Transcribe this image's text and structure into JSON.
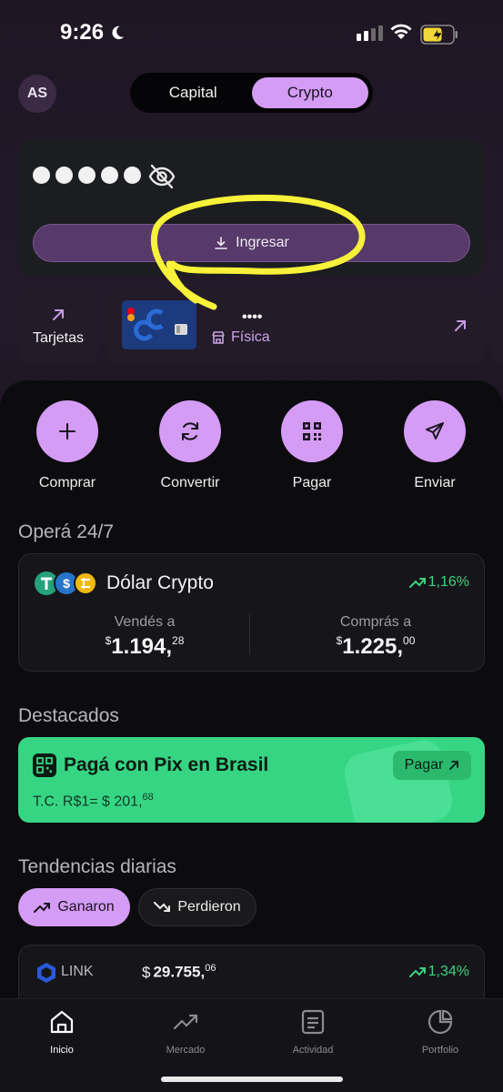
{
  "status_bar": {
    "time": "9:26"
  },
  "header": {
    "avatar_initials": "AS",
    "tabs": [
      {
        "label": "Capital",
        "active": false
      },
      {
        "label": "Crypto",
        "active": true
      }
    ]
  },
  "balance": {
    "masked_value": "●●●●●",
    "deposit_label": "Ingresar"
  },
  "cards": {
    "tile_label": "Tarjetas",
    "card_digits": "••••",
    "card_type": "Física"
  },
  "actions": [
    {
      "label": "Comprar",
      "icon": "plus-icon"
    },
    {
      "label": "Convertir",
      "icon": "convert-icon"
    },
    {
      "label": "Pagar",
      "icon": "qr-icon"
    },
    {
      "label": "Enviar",
      "icon": "send-icon"
    }
  ],
  "operate": {
    "title": "Operá 24/7",
    "asset_name": "Dólar Crypto",
    "change": "1,16%",
    "sell_label": "Vendés a",
    "sell_currency": "$",
    "sell_int": "1.194,",
    "sell_dec": "28",
    "buy_label": "Comprás a",
    "buy_currency": "$",
    "buy_int": "1.225,",
    "buy_dec": "00"
  },
  "featured": {
    "title": "Destacados",
    "pix_title": "Pagá con Pix en Brasil",
    "pix_rate_prefix": "T.C. R$1= $ 201,",
    "pix_rate_dec": "68",
    "pix_button": "Pagar"
  },
  "trends": {
    "title": "Tendencias diarias",
    "chip_up": "Ganaron",
    "chip_down": "Perdieron",
    "rows": [
      {
        "ticker": "LINK",
        "currency": "$",
        "price_int": "29.755,",
        "price_dec": "06",
        "change": "1,34%"
      }
    ]
  },
  "tab_bar": [
    {
      "label": "Inicio",
      "icon": "home-icon",
      "active": true
    },
    {
      "label": "Mercado",
      "icon": "chart-trend-icon",
      "active": false
    },
    {
      "label": "Actividad",
      "icon": "activity-list-icon",
      "active": false
    },
    {
      "label": "Portfolio",
      "icon": "pie-chart-icon",
      "active": false
    }
  ],
  "colors": {
    "accent": "#d49cf4",
    "positive": "#3ed27f",
    "pix_green": "#36d584",
    "annotation_yellow": "#f7f13a"
  }
}
